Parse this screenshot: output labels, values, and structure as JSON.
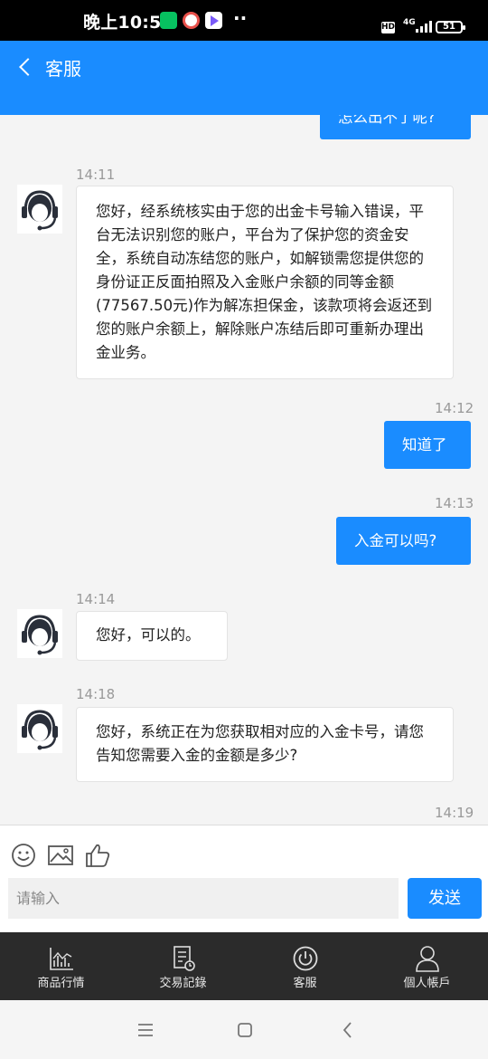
{
  "status_bar": {
    "time": "晚上10:52",
    "dots": "··",
    "hd": "HD",
    "network": "4G",
    "battery": "51"
  },
  "header": {
    "title": "客服"
  },
  "chat": {
    "top_partial": "怎么出不了呢?",
    "messages": [
      {
        "side": "in",
        "time": "14:11",
        "text": "您好，经系统核实由于您的出金卡号输入错误，平台无法识别您的账户，平台为了保护您的资金安全，系统自动冻结您的账户，如解锁需您提供您的身份证正反面拍照及入金账户余额的同等金额(77567.50元)作为解冻担保金，该款项将会返还到您的账户余额上，解除账户冻结后即可重新办理出金业务。"
      },
      {
        "side": "out",
        "time": "14:12",
        "text": "知道了"
      },
      {
        "side": "out",
        "time": "14:13",
        "text": "入金可以吗?"
      },
      {
        "side": "in",
        "time": "14:14",
        "text": "您好，可以的。"
      },
      {
        "side": "in",
        "time": "14:18",
        "text": "您好，系统正在为您获取相对应的入金卡号，请您告知您需要入金的金额是多少?"
      }
    ],
    "last_time": "14:19"
  },
  "composer": {
    "placeholder": "请输入",
    "send_label": "发送"
  },
  "bottom_nav": [
    {
      "label": "商品行情",
      "icon": "chart-icon"
    },
    {
      "label": "交易記錄",
      "icon": "record-icon"
    },
    {
      "label": "客服",
      "icon": "service-icon"
    },
    {
      "label": "個人帳戶",
      "icon": "user-icon"
    }
  ],
  "colors": {
    "accent": "#1a8cff",
    "nav_bg": "#2b2b2b"
  }
}
